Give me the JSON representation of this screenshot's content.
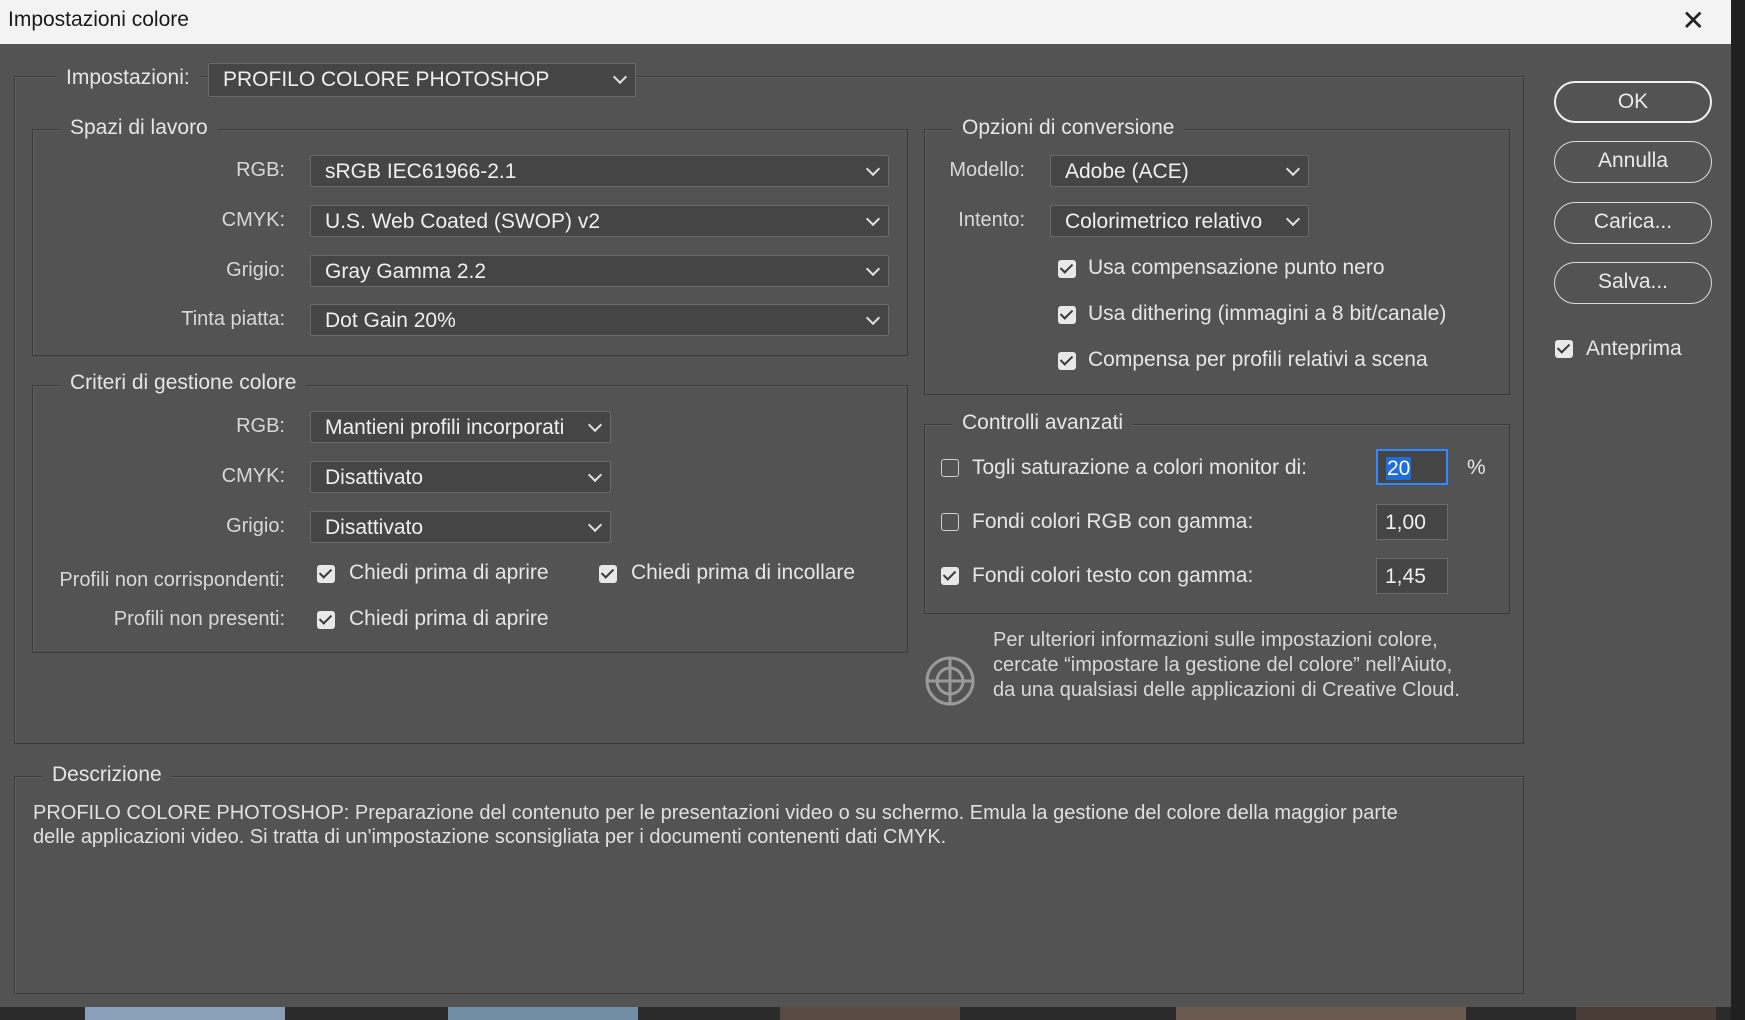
{
  "window": {
    "title": "Impostazioni colore"
  },
  "settings": {
    "label": "Impostazioni:",
    "value": "PROFILO COLORE PHOTOSHOP"
  },
  "working_spaces": {
    "title": "Spazi di lavoro",
    "rows": [
      {
        "label": "RGB:",
        "value": "sRGB IEC61966-2.1"
      },
      {
        "label": "CMYK:",
        "value": "U.S. Web Coated (SWOP) v2"
      },
      {
        "label": "Grigio:",
        "value": "Gray Gamma 2.2"
      },
      {
        "label": "Tinta piatta:",
        "value": "Dot Gain 20%"
      }
    ]
  },
  "policies": {
    "title": "Criteri di gestione colore",
    "rows": [
      {
        "label": "RGB:",
        "value": "Mantieni profili incorporati"
      },
      {
        "label": "CMYK:",
        "value": "Disattivato"
      },
      {
        "label": "Grigio:",
        "value": "Disattivato"
      }
    ],
    "mismatch_label": "Profili non corrispondenti:",
    "mismatch_open": {
      "label": "Chiedi prima di aprire",
      "checked": true
    },
    "mismatch_paste": {
      "label": "Chiedi prima di incollare",
      "checked": true
    },
    "missing_label": "Profili non presenti:",
    "missing_open": {
      "label": "Chiedi prima di aprire",
      "checked": true
    }
  },
  "conversion": {
    "title": "Opzioni di conversione",
    "engine_label": "Modello:",
    "engine_value": "Adobe (ACE)",
    "intent_label": "Intento:",
    "intent_value": "Colorimetrico relativo",
    "options": [
      {
        "label": "Usa compensazione punto nero",
        "checked": true
      },
      {
        "label": "Usa dithering (immagini a 8 bit/canale)",
        "checked": true
      },
      {
        "label": "Compensa per profili relativi a scena",
        "checked": true
      }
    ]
  },
  "advanced": {
    "title": "Controlli avanzati",
    "desaturate": {
      "label": "Togli saturazione a colori monitor di:",
      "checked": false,
      "value": "20",
      "unit": "%"
    },
    "blend_rgb": {
      "label": "Fondi colori RGB con gamma:",
      "checked": false,
      "value": "1,00"
    },
    "blend_text": {
      "label": "Fondi colori testo con gamma:",
      "checked": true,
      "value": "1,45"
    }
  },
  "info": {
    "line1": "Per ulteriori informazioni sulle impostazioni colore,",
    "line2": "cercate “impostare la gestione del colore” nell’Aiuto,",
    "line3": "da una qualsiasi delle applicazioni di Creative Cloud."
  },
  "description": {
    "title": "Descrizione",
    "line1": "PROFILO COLORE PHOTOSHOP:  Preparazione del contenuto per le presentazioni video o su schermo. Emula la gestione del colore della maggior parte",
    "line2": "delle applicazioni video. Si tratta di un'impostazione sconsigliata per i documenti contenenti dati CMYK."
  },
  "buttons": {
    "ok": "OK",
    "cancel": "Annulla",
    "load": "Carica...",
    "save": "Salva..."
  },
  "preview": {
    "label": "Anteprima",
    "checked": true
  },
  "icons": {
    "close": "close-icon",
    "chevron": "chevron-down-icon",
    "info": "color-wheel-icon",
    "check": "checkmark-icon"
  }
}
